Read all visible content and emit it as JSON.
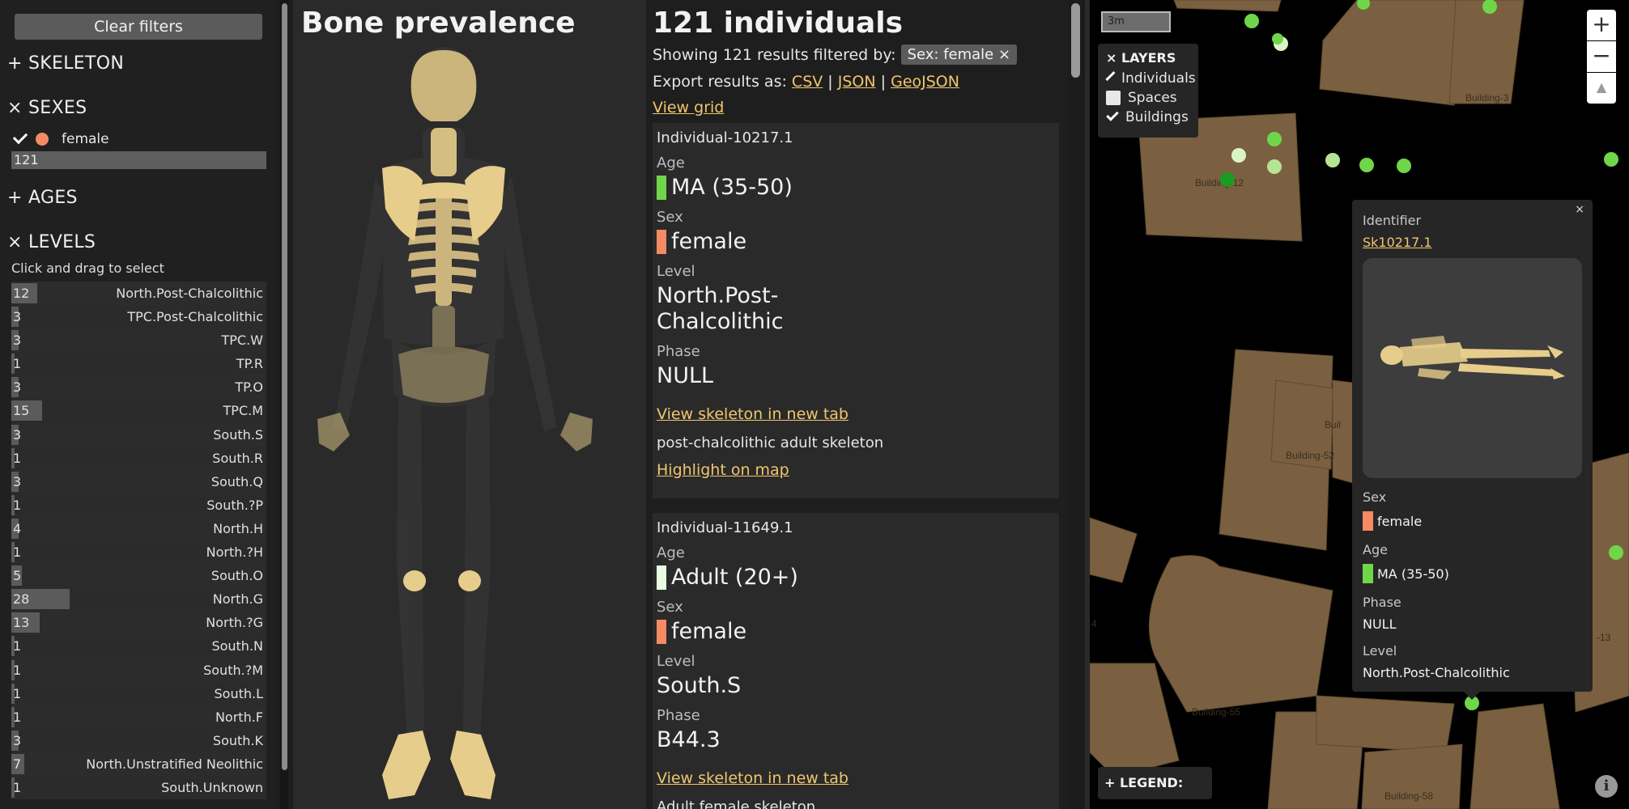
{
  "filters": {
    "clear_label": "Clear filters",
    "skeleton_section": "+ SKELETON",
    "sexes_section": "× SEXES",
    "sex_option": "female",
    "sex_count": "121",
    "ages_section": "+ AGES",
    "levels_section": "× LEVELS",
    "levels_hint": "Click and drag to select",
    "levels": [
      {
        "count": "12",
        "name": "North.Post-Chalcolithic",
        "fill": 0.1
      },
      {
        "count": "3",
        "name": "TPC.Post-Chalcolithic",
        "fill": 0.03
      },
      {
        "count": "3",
        "name": "TPC.W",
        "fill": 0.03
      },
      {
        "count": "1",
        "name": "TP.R",
        "fill": 0.01
      },
      {
        "count": "3",
        "name": "TP.O",
        "fill": 0.03
      },
      {
        "count": "15",
        "name": "TPC.M",
        "fill": 0.12
      },
      {
        "count": "3",
        "name": "South.S",
        "fill": 0.03
      },
      {
        "count": "1",
        "name": "South.R",
        "fill": 0.01
      },
      {
        "count": "3",
        "name": "South.Q",
        "fill": 0.03
      },
      {
        "count": "1",
        "name": "South.?P",
        "fill": 0.01
      },
      {
        "count": "4",
        "name": "North.H",
        "fill": 0.03
      },
      {
        "count": "1",
        "name": "North.?H",
        "fill": 0.01
      },
      {
        "count": "5",
        "name": "South.O",
        "fill": 0.04
      },
      {
        "count": "28",
        "name": "North.G",
        "fill": 0.23
      },
      {
        "count": "13",
        "name": "North.?G",
        "fill": 0.11
      },
      {
        "count": "1",
        "name": "South.N",
        "fill": 0.01
      },
      {
        "count": "1",
        "name": "South.?M",
        "fill": 0.01
      },
      {
        "count": "1",
        "name": "South.L",
        "fill": 0.01
      },
      {
        "count": "1",
        "name": "North.F",
        "fill": 0.01
      },
      {
        "count": "3",
        "name": "South.K",
        "fill": 0.03
      },
      {
        "count": "7",
        "name": "North.Unstratified Neolithic",
        "fill": 0.05
      },
      {
        "count": "1",
        "name": "South.Unknown",
        "fill": 0.01
      }
    ]
  },
  "bones": {
    "title": "Bone prevalence"
  },
  "results": {
    "title": "121 individuals",
    "filter_prefix": "Showing 121 results filtered by:",
    "filter_chip": "Sex: female ×",
    "export_prefix": "Export results as:",
    "export_csv": "CSV",
    "export_sep": "|",
    "export_json": "JSON",
    "export_geojson": "GeoJSON",
    "view_grid": "View grid",
    "cards": [
      {
        "identifier": "Individual-10217.1",
        "age_label": "Age",
        "age": "MA (35-50)",
        "age_color": "#6fd64a",
        "sex_label": "Sex",
        "sex": "female",
        "sex_color": "#f58b63",
        "level_label": "Level",
        "level_line1": "North.Post-",
        "level_line2": "Chalcolithic",
        "phase_label": "Phase",
        "phase": "NULL",
        "view_link": "View skeleton in new tab",
        "description": "post-chalcolithic adult skeleton",
        "highlight_link": "Highlight on map"
      },
      {
        "identifier": "Individual-11649.1",
        "age_label": "Age",
        "age": "Adult (20+)",
        "age_color": "#e9fbe0",
        "sex_label": "Sex",
        "sex": "female",
        "sex_color": "#f58b63",
        "level_label": "Level",
        "level": "South.S",
        "phase_label": "Phase",
        "phase": "B44.3",
        "view_link": "View skeleton in new tab",
        "description": "Adult female skeleton"
      }
    ]
  },
  "map": {
    "scale_label": "3m",
    "layers_title": "× LAYERS",
    "layers": [
      {
        "label": "Individuals",
        "checked": true
      },
      {
        "label": "Spaces",
        "checked": false
      },
      {
        "label": "Buildings",
        "checked": true
      }
    ],
    "zoom_in": "+",
    "zoom_out": "−",
    "reset_north": "▲",
    "legend_label": "+ LEGEND: AGE",
    "info": "i",
    "building_labels": [
      "Building-3",
      "Building-12",
      "Building-52",
      "Buil",
      "Building-55",
      "Building-58",
      "4",
      "-13"
    ],
    "popup": {
      "close": "×",
      "identifier_label": "Identifier",
      "identifier": "Sk10217.1",
      "sex_label": "Sex",
      "sex": "female",
      "sex_color": "#f58b63",
      "age_label": "Age",
      "age": "MA (35-50)",
      "age_color": "#6fd64a",
      "phase_label": "Phase",
      "phase": "NULL",
      "level_label": "Level",
      "level": "North.Post-Chalcolithic"
    }
  },
  "colors": {
    "accent_link": "#f0c66e",
    "building_fill": "#7a6040",
    "bone": "#e7cd8b"
  }
}
